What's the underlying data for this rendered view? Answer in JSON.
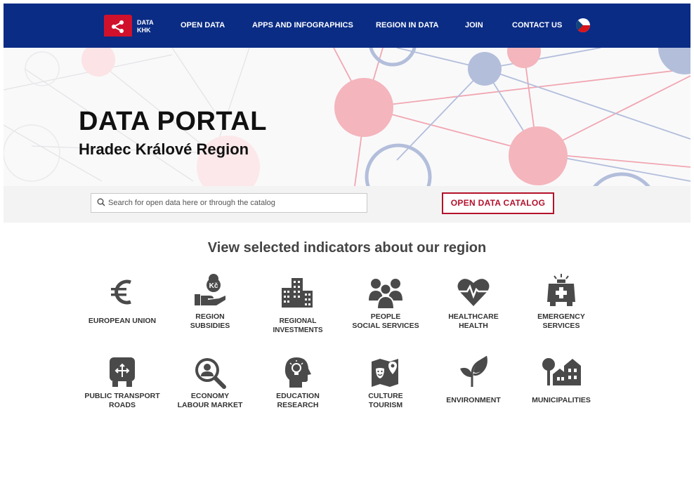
{
  "header": {
    "logo_text_line1": "DATA",
    "logo_text_line2": "KHK",
    "nav": [
      {
        "label": "OPEN DATA"
      },
      {
        "label": "APPS AND INFOGRAPHICS"
      },
      {
        "label": "REGION IN DATA"
      },
      {
        "label": "JOIN"
      },
      {
        "label": "CONTACT US"
      }
    ],
    "language_flag": "czech-flag"
  },
  "hero": {
    "title": "DATA PORTAL",
    "subtitle": "Hradec Králové Region"
  },
  "search": {
    "placeholder": "Search for open data here or through the catalog",
    "value": "",
    "catalog_button": "OPEN DATA CATALOG"
  },
  "indicators": {
    "heading": "View selected indicators about our region",
    "items": [
      {
        "line1": "EUROPEAN UNION",
        "line2": "",
        "icon": "euro-icon"
      },
      {
        "line1": "REGION",
        "line2": "SUBSIDIES",
        "icon": "coin-hand-icon"
      },
      {
        "line1": "REGIONAL INVESTMENTS",
        "line2": "",
        "icon": "buildings-icon"
      },
      {
        "line1": "PEOPLE",
        "line2": "SOCIAL SERVICES",
        "icon": "people-icon"
      },
      {
        "line1": "HEALTHCARE",
        "line2": "HEALTH",
        "icon": "heart-pulse-icon"
      },
      {
        "line1": "EMERGENCY",
        "line2": "SERVICES",
        "icon": "ambulance-icon"
      },
      {
        "line1": "PUBLIC TRANSPORT",
        "line2": "ROADS",
        "icon": "bus-icon"
      },
      {
        "line1": "ECONOMY",
        "line2": "LABOUR MARKET",
        "icon": "magnifier-person-icon"
      },
      {
        "line1": "EDUCATION",
        "line2": "RESEARCH",
        "icon": "head-lightbulb-icon"
      },
      {
        "line1": "CULTURE",
        "line2": "TOURISM",
        "icon": "map-theatre-icon"
      },
      {
        "line1": "ENVIRONMENT",
        "line2": "",
        "icon": "sprout-icon"
      },
      {
        "line1": "MUNICIPALITIES",
        "line2": "",
        "icon": "houses-tree-icon"
      }
    ]
  },
  "colors": {
    "nav_bg": "#0a2c85",
    "brand_red": "#d0112b",
    "catalog_red": "#b3122c",
    "icon_gray": "#4a4a4a"
  }
}
